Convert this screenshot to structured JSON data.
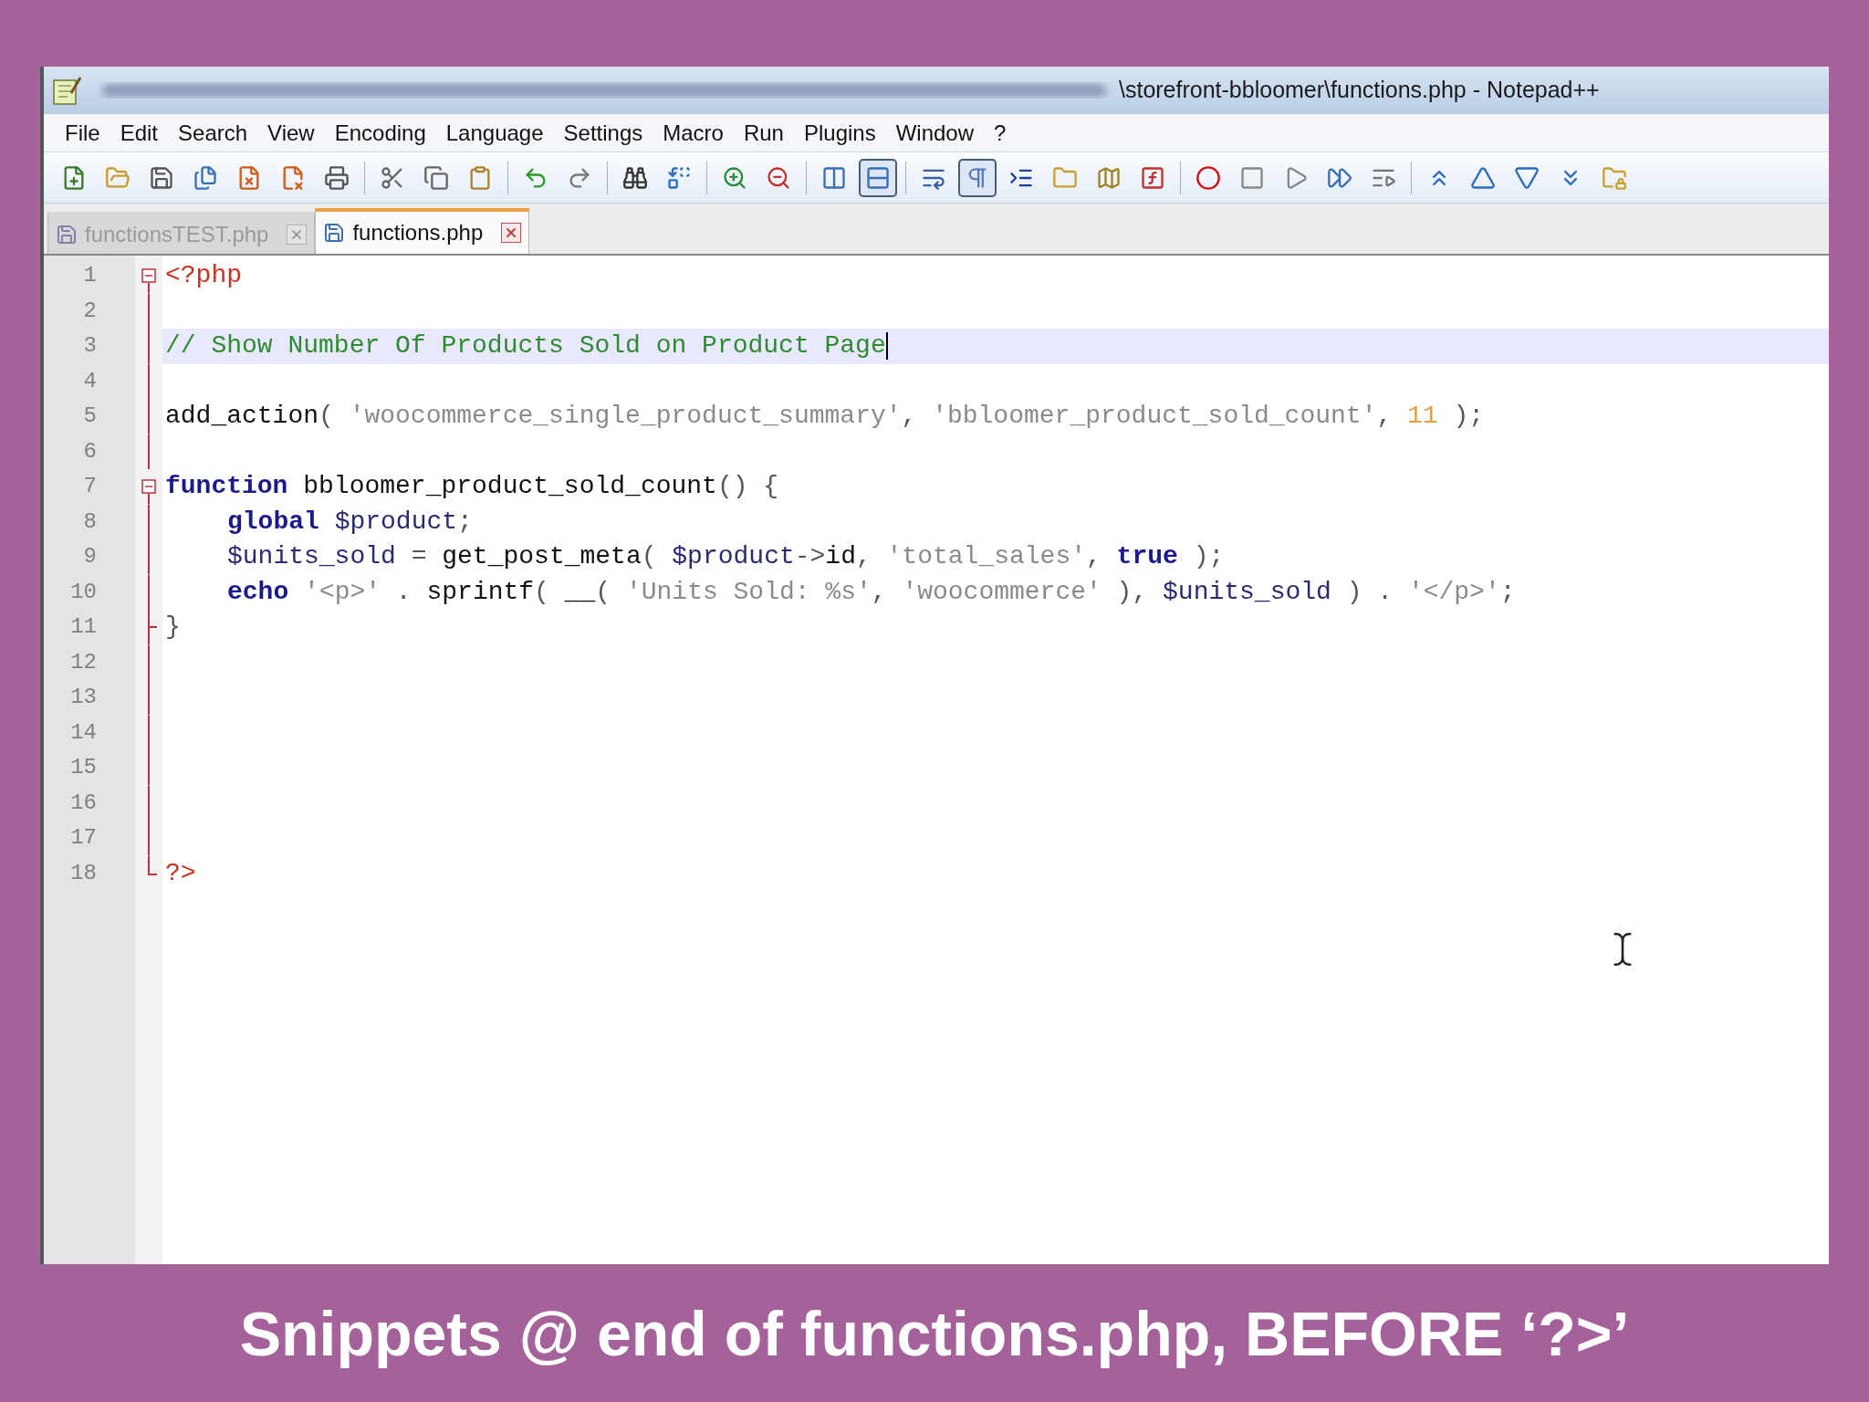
{
  "window": {
    "title": "\\storefront-bbloomer\\functions.php - Notepad++"
  },
  "menu": [
    "File",
    "Edit",
    "Search",
    "View",
    "Encoding",
    "Language",
    "Settings",
    "Macro",
    "Run",
    "Plugins",
    "Window",
    "?"
  ],
  "toolbar": [
    {
      "pressed": false
    },
    {
      "pressed": false
    },
    {
      "pressed": false
    },
    {
      "pressed": false
    },
    {
      "pressed": false
    },
    {
      "pressed": false
    },
    {
      "pressed": false
    },
    {
      "pressed": false
    },
    {
      "pressed": false
    },
    {
      "pressed": false
    },
    {
      "pressed": false
    },
    {
      "pressed": false
    },
    {
      "pressed": false
    },
    {
      "pressed": false
    },
    {
      "pressed": false
    },
    {
      "pressed": false
    },
    {
      "pressed": false
    },
    {
      "pressed": true
    },
    {
      "pressed": false
    },
    {
      "pressed": true
    },
    {
      "pressed": false
    },
    {
      "pressed": false
    },
    {
      "pressed": false
    },
    {
      "pressed": false
    },
    {
      "pressed": false
    },
    {
      "pressed": false
    },
    {
      "pressed": false
    },
    {
      "pressed": false
    },
    {
      "pressed": false
    },
    {
      "pressed": false
    },
    {
      "pressed": false
    },
    {
      "pressed": false
    },
    {
      "pressed": false
    },
    {
      "pressed": false
    }
  ],
  "tabs": [
    {
      "label": "functionsTEST.php",
      "selected": false
    },
    {
      "label": "functions.php",
      "selected": true
    }
  ],
  "editor": {
    "lines": [
      {
        "number": "1",
        "kind": "head",
        "current": false,
        "indented": false,
        "tokens": [
          {
            "kind": "phptag",
            "text": "<?php"
          }
        ]
      },
      {
        "number": "2",
        "kind": "line",
        "current": false
      },
      {
        "number": "3",
        "kind": "line",
        "current": true,
        "indented": false,
        "tokens": [
          {
            "kind": "comment",
            "text": "// Show Number Of Products Sold on Product Page"
          }
        ]
      },
      {
        "number": "4",
        "kind": "line",
        "current": false
      },
      {
        "number": "5",
        "kind": "line",
        "current": false,
        "indented": false,
        "tokens": [
          {
            "kind": "default",
            "text": "add_action"
          },
          {
            "kind": "op",
            "text": "( "
          },
          {
            "kind": "string",
            "text": "'woocommerce_single_product_summary'"
          },
          {
            "kind": "op",
            "text": ", "
          },
          {
            "kind": "string",
            "text": "'bbloomer_product_sold_count'"
          },
          {
            "kind": "op",
            "text": ", "
          },
          {
            "kind": "number",
            "text": "11"
          },
          {
            "kind": "op",
            "text": " );"
          }
        ]
      },
      {
        "number": "6",
        "kind": "line",
        "current": false
      },
      {
        "number": "7",
        "kind": "head",
        "current": false,
        "indented": false,
        "tokens": [
          {
            "kind": "keyword",
            "text": "function"
          },
          {
            "kind": "default",
            "text": " bbloomer_product_sold_count"
          },
          {
            "kind": "op",
            "text": "() {"
          }
        ]
      },
      {
        "number": "8",
        "kind": "line",
        "current": false,
        "indented": true,
        "tokens": [
          {
            "kind": "keyword",
            "text": "global"
          },
          {
            "kind": "variable",
            "text": " $product"
          },
          {
            "kind": "op",
            "text": ";"
          }
        ]
      },
      {
        "number": "9",
        "kind": "line",
        "current": false,
        "indented": true,
        "tokens": [
          {
            "kind": "variable",
            "text": "$units_sold"
          },
          {
            "kind": "op",
            "text": " = "
          },
          {
            "kind": "default",
            "text": "get_post_meta"
          },
          {
            "kind": "op",
            "text": "( "
          },
          {
            "kind": "variable",
            "text": "$product"
          },
          {
            "kind": "op",
            "text": "->"
          },
          {
            "kind": "default",
            "text": "id"
          },
          {
            "kind": "op",
            "text": ", "
          },
          {
            "kind": "string",
            "text": "'total_sales'"
          },
          {
            "kind": "op",
            "text": ", "
          },
          {
            "kind": "keyword",
            "text": "true"
          },
          {
            "kind": "op",
            "text": " );"
          }
        ]
      },
      {
        "number": "10",
        "kind": "line",
        "current": false,
        "indented": true,
        "tokens": [
          {
            "kind": "keyword",
            "text": "echo"
          },
          {
            "kind": "string",
            "text": " '<p>'"
          },
          {
            "kind": "op",
            "text": " . "
          },
          {
            "kind": "default",
            "text": "sprintf"
          },
          {
            "kind": "op",
            "text": "( "
          },
          {
            "kind": "default",
            "text": "__"
          },
          {
            "kind": "op",
            "text": "( "
          },
          {
            "kind": "string",
            "text": "'Units Sold: %s'"
          },
          {
            "kind": "op",
            "text": ", "
          },
          {
            "kind": "string",
            "text": "'woocommerce'"
          },
          {
            "kind": "op",
            "text": " ), "
          },
          {
            "kind": "variable",
            "text": "$units_sold"
          },
          {
            "kind": "op",
            "text": " ) . "
          },
          {
            "kind": "string",
            "text": "'</p>'"
          },
          {
            "kind": "op",
            "text": ";"
          }
        ]
      },
      {
        "number": "11",
        "kind": "tail",
        "current": false,
        "indented": false,
        "tokens": [
          {
            "kind": "op",
            "text": "}"
          }
        ]
      },
      {
        "number": "12",
        "kind": "line",
        "current": false
      },
      {
        "number": "13",
        "kind": "line",
        "current": false
      },
      {
        "number": "14",
        "kind": "line",
        "current": false
      },
      {
        "number": "15",
        "kind": "line",
        "current": false
      },
      {
        "number": "16",
        "kind": "line",
        "current": false
      },
      {
        "number": "17",
        "kind": "line",
        "current": false
      },
      {
        "number": "18",
        "kind": "end",
        "current": false,
        "indented": false,
        "tokens": [
          {
            "kind": "phptag",
            "text": "?>"
          }
        ]
      }
    ]
  },
  "caption": "Snippets @ end of functions.php, BEFORE ‘?>’"
}
